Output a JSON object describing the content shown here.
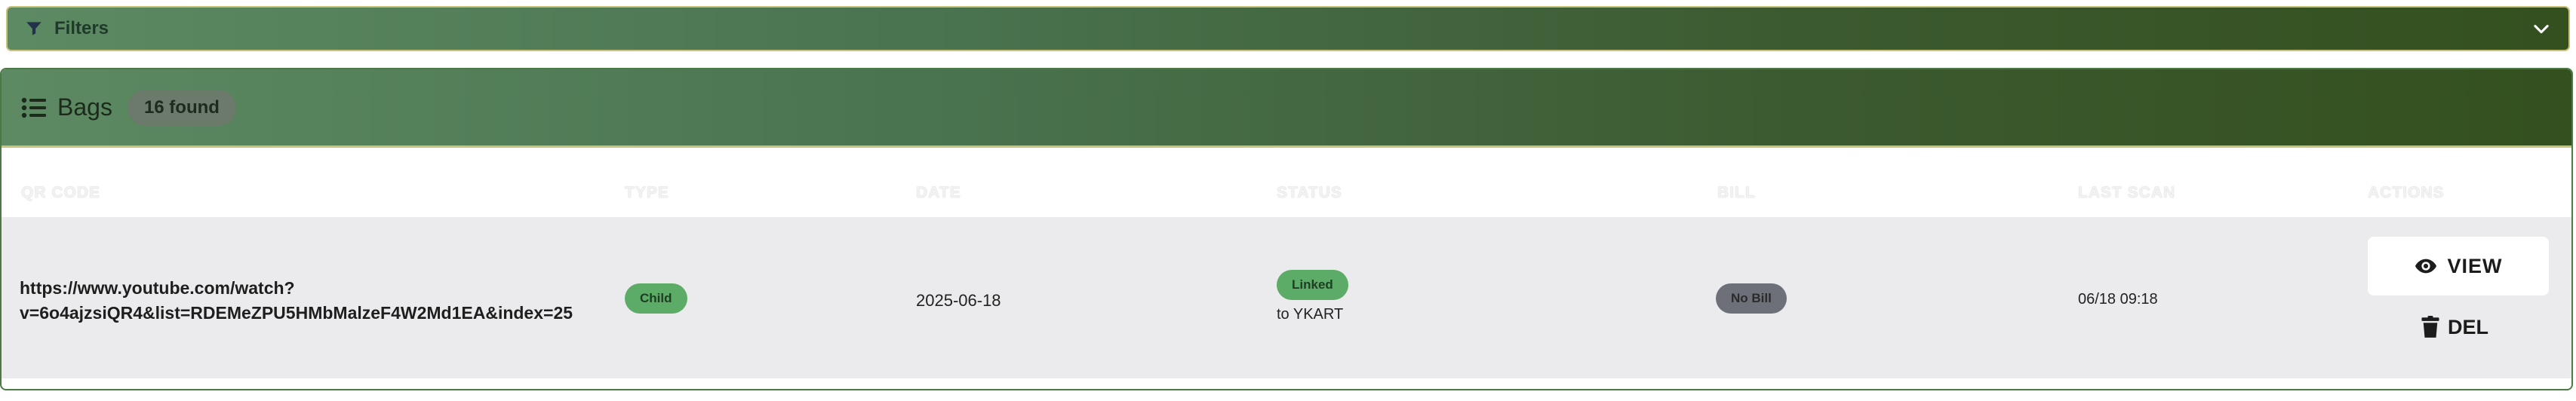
{
  "filters": {
    "label": "Filters"
  },
  "bags": {
    "title": "Bags",
    "found_badge": "16 found",
    "columns": [
      "QR CODE",
      "TYPE",
      "DATE",
      "STATUS",
      "BILL",
      "LAST SCAN",
      "ACTIONS"
    ],
    "rows": [
      {
        "qr_code_line1": "https://www.youtube.com/watch?",
        "qr_code_line2": "v=6o4ajzsiQR4&list=RDEMeZPU5HMbMalzeF4W2Md1EA&index=25",
        "type": "Child",
        "date": "2025-06-18",
        "status": "Linked",
        "linked_to": "to YKART",
        "bill": "No Bill",
        "last_scan": "06/18 09:18",
        "view_label": "VIEW",
        "delete_label": "DEL"
      }
    ]
  },
  "colors": {
    "header_gradient_start": "#5d8a62",
    "header_gradient_end": "#34501f",
    "accent_border": "#c9c27a",
    "pill_green": "#5cab67",
    "pill_gray": "#6e7079"
  },
  "icons": {
    "filter": "filter-icon",
    "chevron": "chevron-down-icon",
    "list": "list-icon",
    "view": "eye-icon",
    "delete": "trash-icon"
  }
}
